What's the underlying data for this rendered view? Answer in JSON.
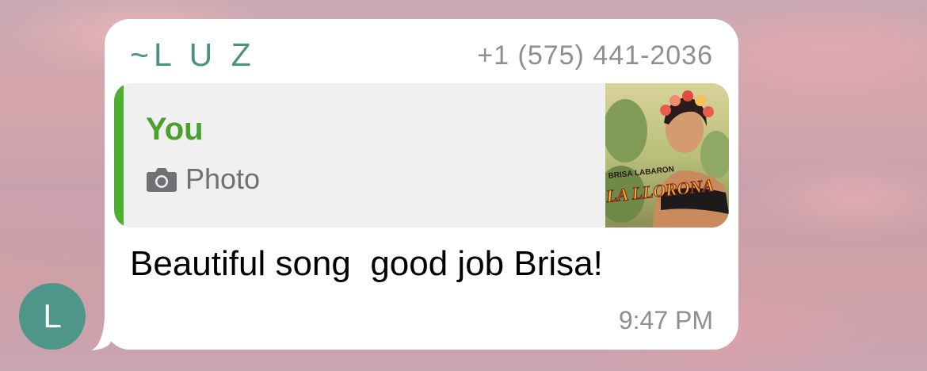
{
  "conversation": {
    "message": {
      "sender": {
        "name": "~L U Z",
        "phone": "+1 (575) 441-2036",
        "avatar_initial": "L",
        "avatar_color": "#4f968a",
        "name_color": "#4b9284"
      },
      "reply_quote": {
        "author": "You",
        "author_color": "#4aa22c",
        "accent_color": "#4caf32",
        "media_icon": "camera-icon",
        "media_type": "Photo",
        "thumbnail": {
          "artist_text": "BRISA LABARON",
          "title_text": "LA LLORONA"
        }
      },
      "text": "Beautiful song  good job Brisa!",
      "time": "9:47 PM"
    }
  }
}
